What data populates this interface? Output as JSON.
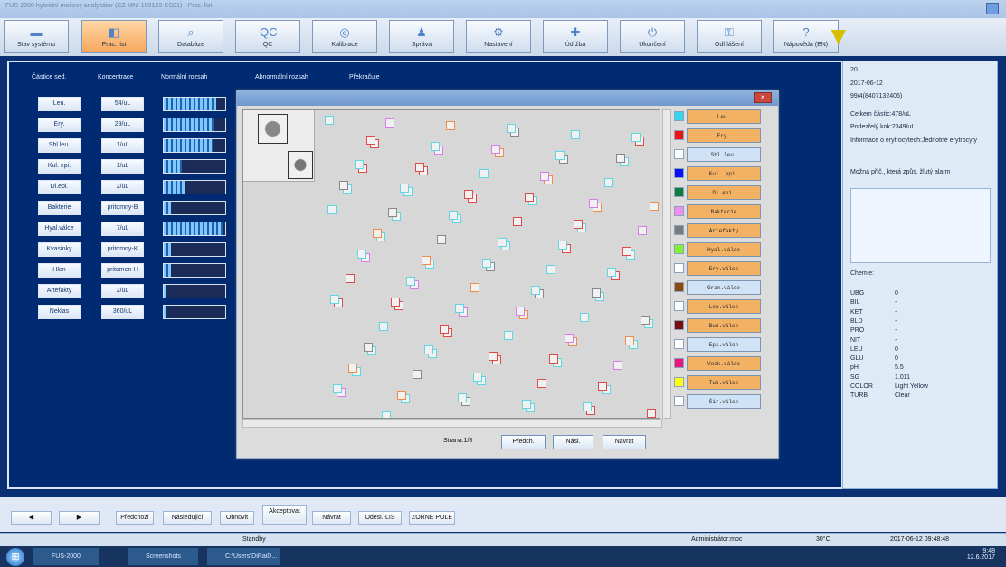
{
  "window": {
    "title": "FUS-2000 hybridní močový analyzátor (CZ-MN: 150123-CS01) - Prac. list"
  },
  "toolbar": [
    {
      "label": "Stav systému",
      "icon": "monitor-icon",
      "glyph": "▬"
    },
    {
      "label": "Prac. list",
      "icon": "worklist-icon",
      "glyph": "◧"
    },
    {
      "label": "Databáze",
      "icon": "database-search-icon",
      "glyph": "⌕"
    },
    {
      "label": "QC",
      "icon": "qc-icon",
      "glyph": "QC"
    },
    {
      "label": "Kalibrace",
      "icon": "target-icon",
      "glyph": "◎"
    },
    {
      "label": "Správa",
      "icon": "admin-user-icon",
      "glyph": "♟"
    },
    {
      "label": "Nastavení",
      "icon": "settings-gear-icon",
      "glyph": "⚙"
    },
    {
      "label": "Údržba",
      "icon": "maintenance-tools-icon",
      "glyph": "✚"
    },
    {
      "label": "Ukončení",
      "icon": "power-icon",
      "glyph": "⏻"
    },
    {
      "label": "Odhlášení",
      "icon": "logout-key-icon",
      "glyph": "⚿"
    },
    {
      "label": "Nápověda (EN)",
      "icon": "help-icon",
      "glyph": "?"
    }
  ],
  "columns": {
    "col1": "Částice sed.",
    "col2": "Koncentrace",
    "col3": "Normální rozsah",
    "col4": "Abnormální rozsah",
    "col5": "Překračuje"
  },
  "rows": [
    {
      "name": "Leu.",
      "value": "54/uL",
      "level": 0.85
    },
    {
      "name": "Ery.",
      "value": "29/uL",
      "level": 0.82
    },
    {
      "name": "Shl.leu.",
      "value": "1/uL",
      "level": 0.8
    },
    {
      "name": "Kul. epi.",
      "value": "1/uL",
      "level": 0.3
    },
    {
      "name": "Dl.epi.",
      "value": "2/uL",
      "level": 0.35
    },
    {
      "name": "Bakterie",
      "value": "pritomny-B",
      "level": 0.12
    },
    {
      "name": "Hyal.válce",
      "value": "7/uL",
      "level": 0.95
    },
    {
      "name": "Kvasinky",
      "value": "pritomny-K",
      "level": 0.12
    },
    {
      "name": "Hlen",
      "value": "pritomen-H",
      "level": 0.12
    },
    {
      "name": "Artefakty",
      "value": "2/uL",
      "level": 0.03
    },
    {
      "name": "Neklas",
      "value": "360/uL",
      "level": 0.03
    }
  ],
  "info": {
    "seq": "20",
    "date": "2017-06-12",
    "sample": "99/4(8407132406)",
    "total": "Celkem částic:478/uL",
    "suspect": "Podezřelý kok:2349/uL",
    "rbc_info": "Informace o erytrocytech:Jednotné erytrocyty",
    "alarm": "Možná příč., která způs. žlutý alarm",
    "chem_title": "Chemie:",
    "chem": [
      {
        "k": "UBG",
        "v": "0"
      },
      {
        "k": "BIL",
        "v": "-"
      },
      {
        "k": "KET",
        "v": "-"
      },
      {
        "k": "BLD",
        "v": "-"
      },
      {
        "k": "PRO",
        "v": "-"
      },
      {
        "k": "NIT",
        "v": "-"
      },
      {
        "k": "LEU",
        "v": "0"
      },
      {
        "k": "GLU",
        "v": "0"
      },
      {
        "k": "pH",
        "v": "5.5"
      },
      {
        "k": "SG",
        "v": "1.011"
      },
      {
        "k": "COLOR",
        "v": "Light Yellow"
      },
      {
        "k": "TURB",
        "v": "Clear"
      }
    ]
  },
  "modal": {
    "page": "Strana:1/8",
    "prev": "Předch.",
    "next": "Násl.",
    "back": "Návrat",
    "legend": [
      {
        "label": "Leu.",
        "color": "#33d6ea",
        "on": true
      },
      {
        "label": "Ery.",
        "color": "#ef1414",
        "on": true
      },
      {
        "label": "Shl.leu.",
        "color": "#ffffff",
        "on": false
      },
      {
        "label": "Kul. epi.",
        "color": "#0a10ff",
        "on": true
      },
      {
        "label": "Dl.epi.",
        "color": "#0f7b3f",
        "on": true
      },
      {
        "label": "Bakterie",
        "color": "#ee8ef4",
        "on": true
      },
      {
        "label": "Artefakty",
        "color": "#7b7b7b",
        "on": true
      },
      {
        "label": "Hyal.válce",
        "color": "#7ef233",
        "on": true
      },
      {
        "label": "Ery.válce",
        "color": "#ffffff",
        "on": true
      },
      {
        "label": "Gran.válce",
        "color": "#8a4b11",
        "on": false
      },
      {
        "label": "Leu.válce",
        "color": "#ffffff",
        "on": true
      },
      {
        "label": "Buň.válce",
        "color": "#7a0d0d",
        "on": true
      },
      {
        "label": "Epi.válce",
        "color": "#ffffff",
        "on": false
      },
      {
        "label": "Vosk.válce",
        "color": "#e9157a",
        "on": true
      },
      {
        "label": "Tuk.válce",
        "color": "#fcff12",
        "on": true
      },
      {
        "label": "Šir.válce",
        "color": "#ffffff",
        "on": false
      }
    ]
  },
  "bottom": {
    "prev": "Předchozí",
    "next": "Následující",
    "refresh": "Obnovit",
    "accept": "Akceptovat",
    "back": "Návrat",
    "send": "Odesl.-LIS",
    "field": "ZORNÉ POLE"
  },
  "status": {
    "state": "Standby",
    "user": "Administrátor:moc",
    "temp": "30°C",
    "datetime": "2017-06-12 09:48:48"
  },
  "taskbar": {
    "app": "FUS-2000",
    "screenshots": "Screenshots",
    "explorer": "C:\\Users\\DiRaiD...",
    "time": "9:48",
    "date": "12.6.2017"
  }
}
